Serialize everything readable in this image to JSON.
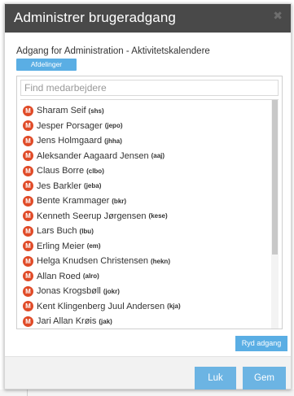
{
  "dialog": {
    "title": "Administrer brugeradgang",
    "close_glyph": "✖",
    "subtitle": "Adgang for Administration - Aktivitetskalendere",
    "departments_label": "Afdelinger"
  },
  "search": {
    "placeholder": "Find medarbejdere",
    "value": ""
  },
  "badge_letter": "M",
  "colors": {
    "titlebar": "#494949",
    "accent": "#5aaee4",
    "badge": "#e04b28"
  },
  "employees": [
    {
      "name": "Sharam Seif",
      "code": "(shs)"
    },
    {
      "name": "Jesper Porsager",
      "code": "(jepo)"
    },
    {
      "name": "Jens Holmgaard",
      "code": "(jhha)"
    },
    {
      "name": "Aleksander Aagaard Jensen",
      "code": "(aaj)"
    },
    {
      "name": "Claus Borre",
      "code": "(clbo)"
    },
    {
      "name": "Jes Barkler",
      "code": "(jeba)"
    },
    {
      "name": "Bente Krammager",
      "code": "(bkr)"
    },
    {
      "name": "Kenneth Seerup Jørgensen",
      "code": "(kese)"
    },
    {
      "name": "Lars Buch",
      "code": "(lbu)"
    },
    {
      "name": "Erling Meier",
      "code": "(em)"
    },
    {
      "name": "Helga Knudsen Christensen",
      "code": "(hekn)"
    },
    {
      "name": "Allan Roed",
      "code": "(alro)"
    },
    {
      "name": "Jonas Krogsbøll",
      "code": "(jokr)"
    },
    {
      "name": "Kent Klingenberg Juul Andersen",
      "code": "(kja)"
    },
    {
      "name": "Jari Allan Krøis",
      "code": "(jak)"
    }
  ],
  "actions": {
    "clear_label": "Ryd adgang",
    "close_label": "Luk",
    "save_label": "Gem"
  }
}
